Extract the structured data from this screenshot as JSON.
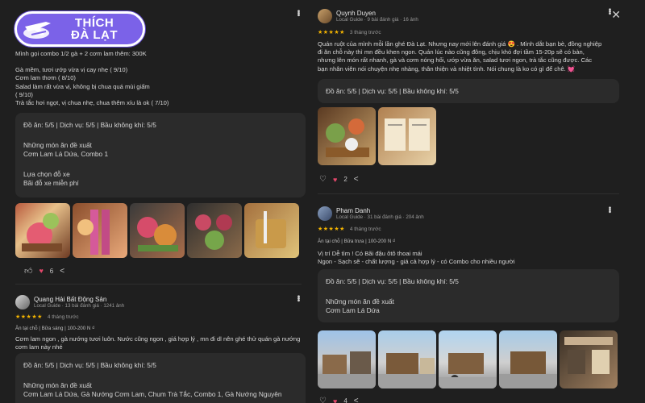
{
  "brand": {
    "line1": "THÍCH",
    "line2": "ĐÀ LẠT"
  },
  "left": {
    "review1": {
      "text_lines": [
        "Mình gọi combo 1/2 gà + 2 cơm lam thêm: 300K",
        "",
        "Gà mềm, tươi ướp vừa vị cay nhẹ ( 9/10)",
        "Cơm lam thơm ( 8/10)",
        "Salad làm rất vừa vị, không bị chua quá mùi giấm",
        " ( 9/10)",
        "Trà tắc hơi ngọt, vị chua nhẹ, chua thêm xíu là ok ( 7/10)"
      ],
      "ratings": "Đồ ăn: 5/5  |  Dịch vụ: 5/5  |  Bầu không khí: 5/5",
      "suggest_title": "Những món ăn đề xuất",
      "suggest_items": "Cơm Lam Lá Dứa, Combo 1",
      "parking_title": "Lựa chọn đỗ xe",
      "parking_value": "Bãi đỗ xe miễn phí",
      "likes": "6"
    },
    "review2": {
      "name": "Quang Hải Bất Động Sản",
      "meta": "Local Guide · 13 bài đánh giá · 1241 ảnh",
      "stars": "★★★★★",
      "time": "4 tháng trước",
      "tags": "Ăn tại chỗ  |  Bữa sáng  |  100-200 N ₫",
      "text_lines": [
        "Cơm lam ngon , gà nướng tươi luôn. Nước cũng ngon , giá hợp lý , mn đi dl nên ghé thử quán gà nướng",
        "cơm lam này nhé"
      ],
      "ratings": "Đồ ăn: 5/5  |  Dịch vụ: 5/5  |  Bầu không khí: 5/5",
      "suggest_title": "Những món ăn đề xuất",
      "suggest_items": "Cơm Lam Lá Dứa, Gà Nướng Cơm Lam, Chum Trà Tắc, Combo 1, Gà Nướng Nguyên"
    }
  },
  "right": {
    "review1": {
      "name": "Quynh Duyen",
      "meta": "Local Guide · 9 bài đánh giá · 16 ảnh",
      "stars": "★★★★★",
      "time": "3 tháng trước",
      "text_lines": [
        "Quán ruột của mình mỗi lần ghé Đà Lạt. Nhưng nay mới lên đánh giá 😍 . Mình dắt bạn bè, đồng nghiệp",
        "đi ăn chỗ này thì mn đều khen ngon. Quán lúc nào cũng đông, chịu khó đợi tầm 15-20p sẽ có bàn,",
        "nhưng lên món rất nhanh, gà và cơm nóng hổi, ướp vừa ăn, salad tươi ngon, trà tắc cũng được. Các",
        "bạn nhân viên nói chuyện nhẹ nhàng, thân thiện và nhiệt tình. Nói chung là ko có gì để chê. 💓"
      ],
      "ratings": "Đồ ăn: 5/5  |  Dịch vụ: 5/5  |  Bầu không khí: 5/5",
      "likes": "2"
    },
    "review2": {
      "name": "Pham Danh",
      "meta": "Local Guide · 31 bài đánh giá · 204 ảnh",
      "stars": "★★★★★",
      "time": "4 tháng trước",
      "tags": "Ăn tại chỗ  |  Bữa trưa  |  100-200 N ₫",
      "text_lines": [
        "Vị trí Dễ tìm ! Có Bãi đậu ôtô thoai mái",
        "Ngon - Sạch sẽ - chất lượng - giá cả hợp lý - có Combo cho nhiều người"
      ],
      "ratings": "Đồ ăn: 5/5  |  Dịch vụ: 5/5  |  Bầu không khí: 5/5",
      "suggest_title": "Những món ăn đề xuất",
      "suggest_items": "Cơm Lam Lá Dứa",
      "likes": "4"
    }
  },
  "icons": [
    "like-outline-icon",
    "heart-icon",
    "share-icon",
    "more-vert-icon",
    "close-icon",
    "logo-plane-icon"
  ]
}
